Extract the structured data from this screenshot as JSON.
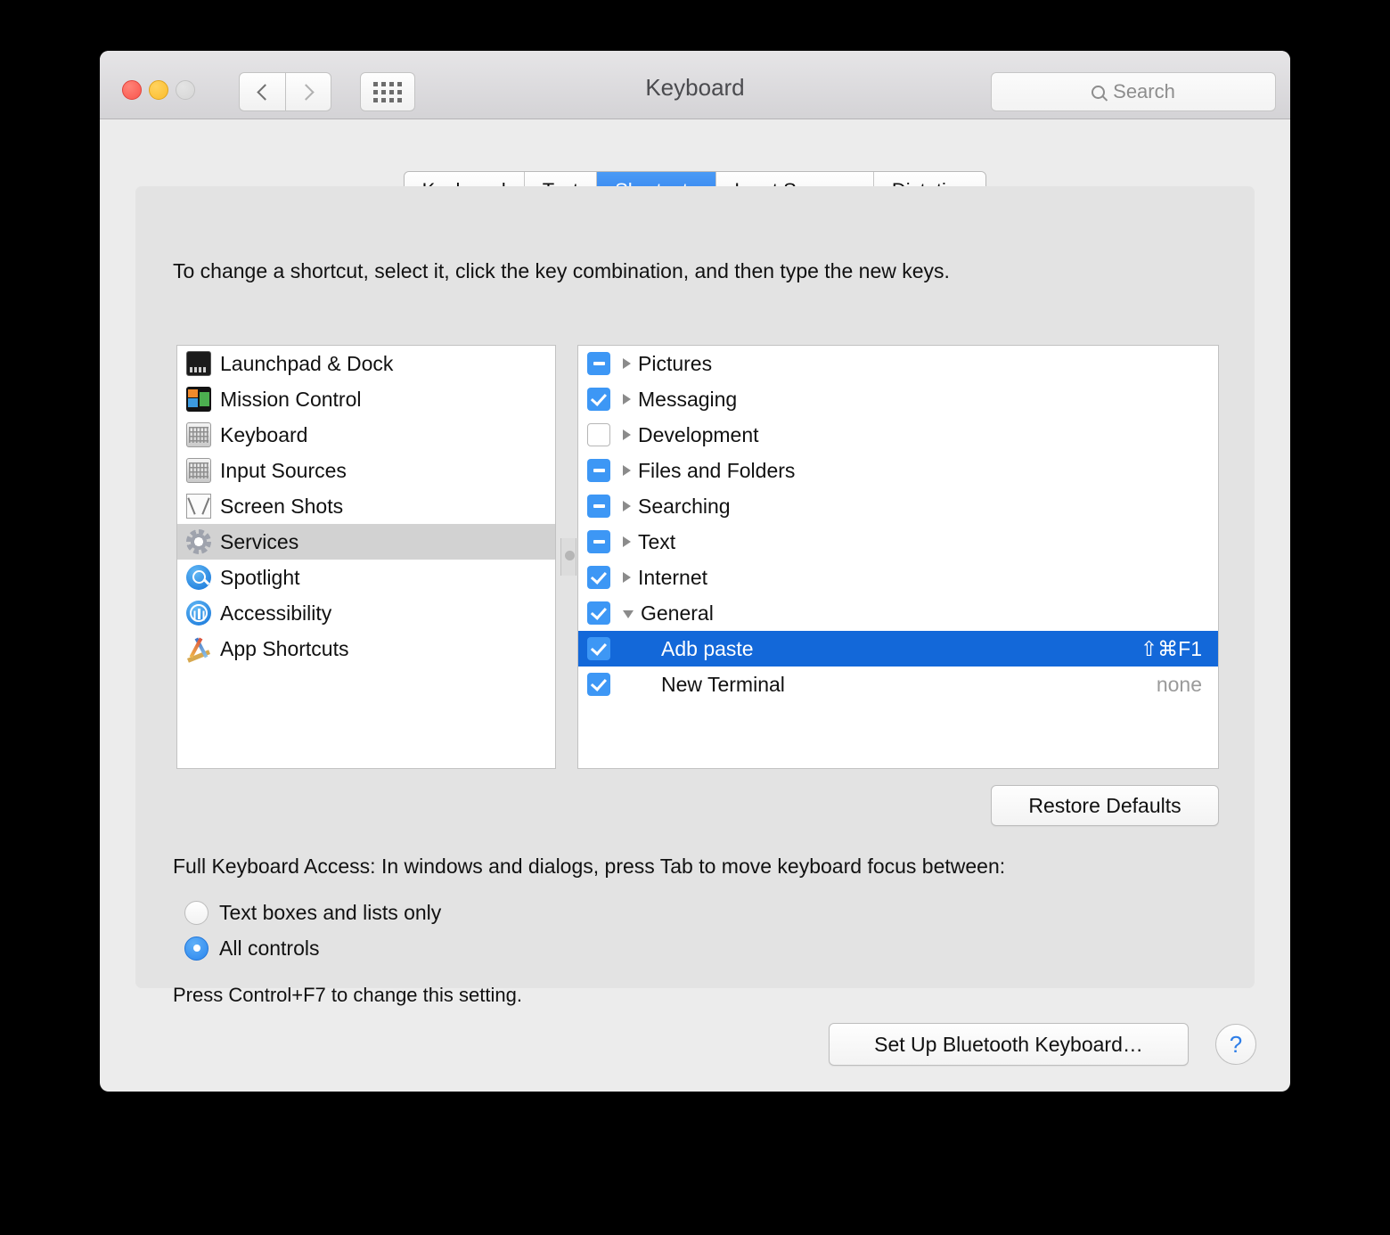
{
  "window": {
    "title": "Keyboard",
    "traffic_lights": [
      "close-button",
      "minimize-button",
      "zoom-button"
    ],
    "back_icon": "chevron-left-icon",
    "forward_icon": "chevron-right-icon",
    "grid_icon": "show-all-grid-icon",
    "search": {
      "placeholder": "Search",
      "icon": "search-icon",
      "value": ""
    }
  },
  "tabs": [
    {
      "label": "Keyboard",
      "active": false
    },
    {
      "label": "Text",
      "active": false
    },
    {
      "label": "Shortcuts",
      "active": true
    },
    {
      "label": "Input Sources",
      "active": false
    },
    {
      "label": "Dictation",
      "active": false
    }
  ],
  "hint": "To change a shortcut, select it, click the key combination, and then type the new keys.",
  "categories": [
    {
      "label": "Launchpad & Dock",
      "icon": "launchpad-dock-icon",
      "selected": false
    },
    {
      "label": "Mission Control",
      "icon": "mission-control-icon",
      "selected": false
    },
    {
      "label": "Keyboard",
      "icon": "keyboard-icon",
      "selected": false
    },
    {
      "label": "Input Sources",
      "icon": "input-sources-icon",
      "selected": false
    },
    {
      "label": "Screen Shots",
      "icon": "screen-shots-icon",
      "selected": false
    },
    {
      "label": "Services",
      "icon": "services-gear-icon",
      "selected": true
    },
    {
      "label": "Spotlight",
      "icon": "spotlight-icon",
      "selected": false
    },
    {
      "label": "Accessibility",
      "icon": "accessibility-icon",
      "selected": false
    },
    {
      "label": "App Shortcuts",
      "icon": "app-shortcuts-icon",
      "selected": false
    }
  ],
  "shortcuts": [
    {
      "label": "Pictures",
      "checkbox": "mixed",
      "disclosure": "collapsed",
      "child": false,
      "selected": false,
      "shortcut": ""
    },
    {
      "label": "Messaging",
      "checkbox": "checked",
      "disclosure": "collapsed",
      "child": false,
      "selected": false,
      "shortcut": ""
    },
    {
      "label": "Development",
      "checkbox": "unchecked",
      "disclosure": "collapsed",
      "child": false,
      "selected": false,
      "shortcut": ""
    },
    {
      "label": "Files and Folders",
      "checkbox": "mixed",
      "disclosure": "collapsed",
      "child": false,
      "selected": false,
      "shortcut": ""
    },
    {
      "label": "Searching",
      "checkbox": "mixed",
      "disclosure": "collapsed",
      "child": false,
      "selected": false,
      "shortcut": ""
    },
    {
      "label": "Text",
      "checkbox": "mixed",
      "disclosure": "collapsed",
      "child": false,
      "selected": false,
      "shortcut": ""
    },
    {
      "label": "Internet",
      "checkbox": "checked",
      "disclosure": "collapsed",
      "child": false,
      "selected": false,
      "shortcut": ""
    },
    {
      "label": "General",
      "checkbox": "checked",
      "disclosure": "expanded",
      "child": false,
      "selected": false,
      "shortcut": ""
    },
    {
      "label": "Adb paste",
      "checkbox": "checked",
      "disclosure": "none",
      "child": true,
      "selected": true,
      "shortcut": "⇧⌘F1"
    },
    {
      "label": "New Terminal",
      "checkbox": "checked",
      "disclosure": "none",
      "child": true,
      "selected": false,
      "shortcut": "none"
    }
  ],
  "buttons": {
    "restore_defaults": "Restore Defaults",
    "bluetooth": "Set Up Bluetooth Keyboard…",
    "help": "?"
  },
  "full_keyboard_access": {
    "heading": "Full Keyboard Access: In windows and dialogs, press Tab to move keyboard focus between:",
    "options": [
      {
        "label": "Text boxes and lists only",
        "selected": false
      },
      {
        "label": "All controls",
        "selected": true
      }
    ],
    "note": "Press Control+F7 to change this setting."
  },
  "colors": {
    "accent_blue": "#3d97f5",
    "selection_blue": "#1368d9",
    "tab_active_blue": "#2f7eed",
    "window_bg": "#ececec",
    "panel_bg": "#e3e3e3"
  }
}
